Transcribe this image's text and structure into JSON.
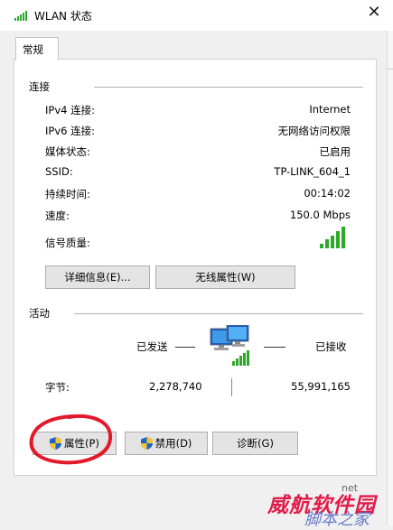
{
  "window": {
    "title": "WLAN 状态",
    "close_glyph": "✕"
  },
  "tabs": [
    {
      "label": "常规"
    }
  ],
  "connection": {
    "section_title": "连接",
    "rows": [
      {
        "label": "IPv4 连接:",
        "value": "Internet"
      },
      {
        "label": "IPv6 连接:",
        "value": "无网络访问权限"
      },
      {
        "label": "媒体状态:",
        "value": "已启用"
      },
      {
        "label": "SSID:",
        "value": "TP-LINK_604_1"
      },
      {
        "label": "持续时间:",
        "value": "00:14:02"
      },
      {
        "label": "速度:",
        "value": "150.0 Mbps"
      },
      {
        "label": "信号质量:",
        "value": ""
      }
    ],
    "signal_quality_bars": 5,
    "buttons": {
      "details": "详细信息(E)...",
      "wireless_props": "无线属性(W)"
    }
  },
  "activity": {
    "section_title": "活动",
    "sent_label": "已发送",
    "received_label": "已接收",
    "bytes_label": "字节:",
    "bytes_sent": "2,278,740",
    "bytes_received": "55,991,165"
  },
  "buttons": {
    "properties": "属性(P)",
    "disable": "禁用(D)",
    "diagnose": "诊断(G)"
  },
  "watermark": {
    "main": "威航软件园",
    "sub": "脚本之家",
    "net": "net"
  },
  "colors": {
    "signal_green": "#2ea82a",
    "annotation_red": "#e3192b",
    "watermark_red": "#e21b4a",
    "watermark_blue": "#5b6dc8"
  },
  "icons": {
    "title": "wifi-signal-icon",
    "shield": "uac-shield-icon",
    "network": "network-computer-icon"
  }
}
